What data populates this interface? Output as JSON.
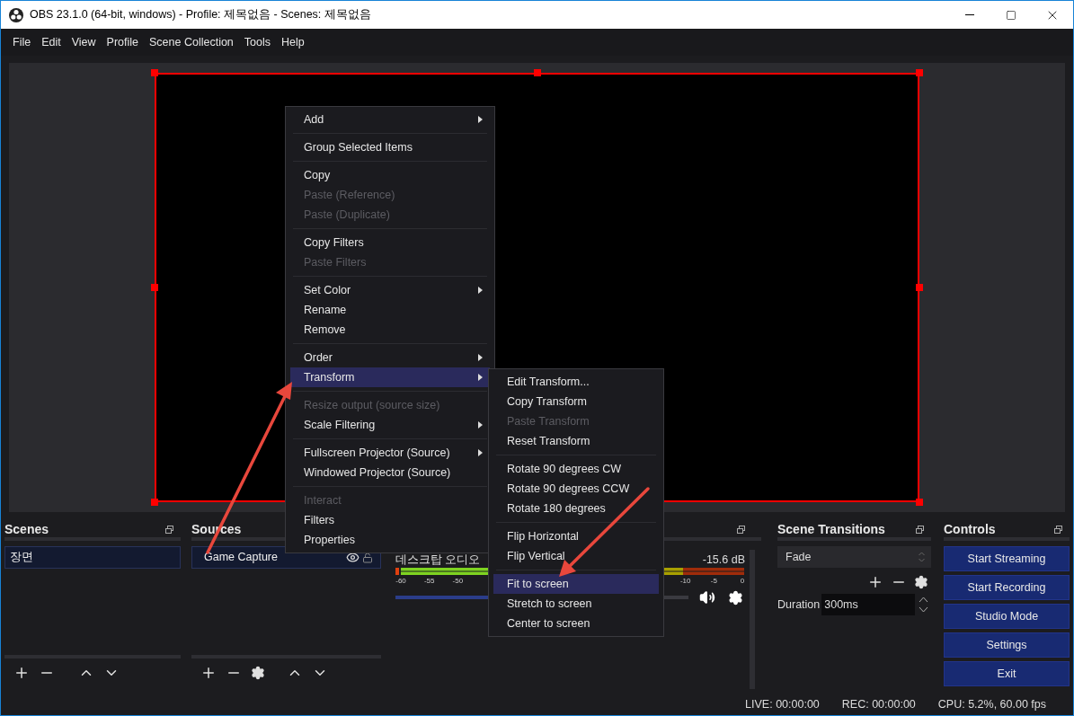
{
  "window": {
    "title": "OBS 23.1.0 (64-bit, windows) - Profile: 제목없음 - Scenes: 제목없음"
  },
  "menu_bar": [
    "File",
    "Edit",
    "View",
    "Profile",
    "Scene Collection",
    "Tools",
    "Help"
  ],
  "scenes": {
    "title": "Scenes",
    "items": [
      {
        "label": "장면",
        "selected": true
      }
    ]
  },
  "sources": {
    "title": "Sources",
    "items": [
      {
        "label": "Game Capture",
        "selected": true,
        "visible": true,
        "locked": false
      }
    ]
  },
  "mixer": {
    "channel": "데스크탑 오디오",
    "reading": "-15.6 dB",
    "ticks": [
      "-60",
      "-55",
      "-50",
      "-10",
      "-5",
      "0"
    ],
    "level": 0.6,
    "muted": false
  },
  "transitions": {
    "title": "Scene Transitions",
    "transition": "Fade",
    "duration_label": "Duration",
    "duration": "300ms"
  },
  "controls": {
    "title": "Controls",
    "buttons": [
      "Start Streaming",
      "Start Recording",
      "Studio Mode",
      "Settings",
      "Exit"
    ]
  },
  "status_bar": {
    "live": "LIVE: 00:00:00",
    "rec": "REC: 00:00:00",
    "cpu": "CPU: 5.2%, 60.00 fps"
  },
  "context_menu": [
    {
      "kind": "item",
      "label": "Add",
      "submenu": true,
      "disabled": false,
      "selected": false
    },
    {
      "kind": "separator"
    },
    {
      "kind": "item",
      "label": "Group Selected Items",
      "submenu": false,
      "disabled": false,
      "selected": false
    },
    {
      "kind": "separator"
    },
    {
      "kind": "item",
      "label": "Copy",
      "submenu": false,
      "disabled": false,
      "selected": false
    },
    {
      "kind": "item",
      "label": "Paste (Reference)",
      "submenu": false,
      "disabled": true,
      "selected": false
    },
    {
      "kind": "item",
      "label": "Paste (Duplicate)",
      "submenu": false,
      "disabled": true,
      "selected": false
    },
    {
      "kind": "separator"
    },
    {
      "kind": "item",
      "label": "Copy Filters",
      "submenu": false,
      "disabled": false,
      "selected": false
    },
    {
      "kind": "item",
      "label": "Paste Filters",
      "submenu": false,
      "disabled": true,
      "selected": false
    },
    {
      "kind": "separator"
    },
    {
      "kind": "item",
      "label": "Set Color",
      "submenu": true,
      "disabled": false,
      "selected": false
    },
    {
      "kind": "item",
      "label": "Rename",
      "submenu": false,
      "disabled": false,
      "selected": false
    },
    {
      "kind": "item",
      "label": "Remove",
      "submenu": false,
      "disabled": false,
      "selected": false
    },
    {
      "kind": "separator"
    },
    {
      "kind": "item",
      "label": "Order",
      "submenu": true,
      "disabled": false,
      "selected": false
    },
    {
      "kind": "item",
      "label": "Transform",
      "submenu": true,
      "disabled": false,
      "selected": true
    },
    {
      "kind": "separator"
    },
    {
      "kind": "item",
      "label": "Resize output (source size)",
      "submenu": false,
      "disabled": true,
      "selected": false
    },
    {
      "kind": "item",
      "label": "Scale Filtering",
      "submenu": true,
      "disabled": false,
      "selected": false
    },
    {
      "kind": "separator"
    },
    {
      "kind": "item",
      "label": "Fullscreen Projector (Source)",
      "submenu": true,
      "disabled": false,
      "selected": false
    },
    {
      "kind": "item",
      "label": "Windowed Projector (Source)",
      "submenu": false,
      "disabled": false,
      "selected": false
    },
    {
      "kind": "separator"
    },
    {
      "kind": "item",
      "label": "Interact",
      "submenu": false,
      "disabled": true,
      "selected": false
    },
    {
      "kind": "item",
      "label": "Filters",
      "submenu": false,
      "disabled": false,
      "selected": false
    },
    {
      "kind": "item",
      "label": "Properties",
      "submenu": false,
      "disabled": false,
      "selected": false
    }
  ],
  "transform_menu": [
    {
      "kind": "item",
      "label": "Edit Transform...",
      "disabled": false,
      "selected": false
    },
    {
      "kind": "item",
      "label": "Copy Transform",
      "disabled": false,
      "selected": false
    },
    {
      "kind": "item",
      "label": "Paste Transform",
      "disabled": true,
      "selected": false
    },
    {
      "kind": "item",
      "label": "Reset Transform",
      "disabled": false,
      "selected": false
    },
    {
      "kind": "separator"
    },
    {
      "kind": "item",
      "label": "Rotate 90 degrees CW",
      "disabled": false,
      "selected": false
    },
    {
      "kind": "item",
      "label": "Rotate 90 degrees CCW",
      "disabled": false,
      "selected": false
    },
    {
      "kind": "item",
      "label": "Rotate 180 degrees",
      "disabled": false,
      "selected": false
    },
    {
      "kind": "separator"
    },
    {
      "kind": "item",
      "label": "Flip Horizontal",
      "disabled": false,
      "selected": false
    },
    {
      "kind": "item",
      "label": "Flip Vertical",
      "disabled": false,
      "selected": false
    },
    {
      "kind": "separator"
    },
    {
      "kind": "item",
      "label": "Fit to screen",
      "disabled": false,
      "selected": true
    },
    {
      "kind": "item",
      "label": "Stretch to screen",
      "disabled": false,
      "selected": false
    },
    {
      "kind": "item",
      "label": "Center to screen",
      "disabled": false,
      "selected": false
    }
  ]
}
